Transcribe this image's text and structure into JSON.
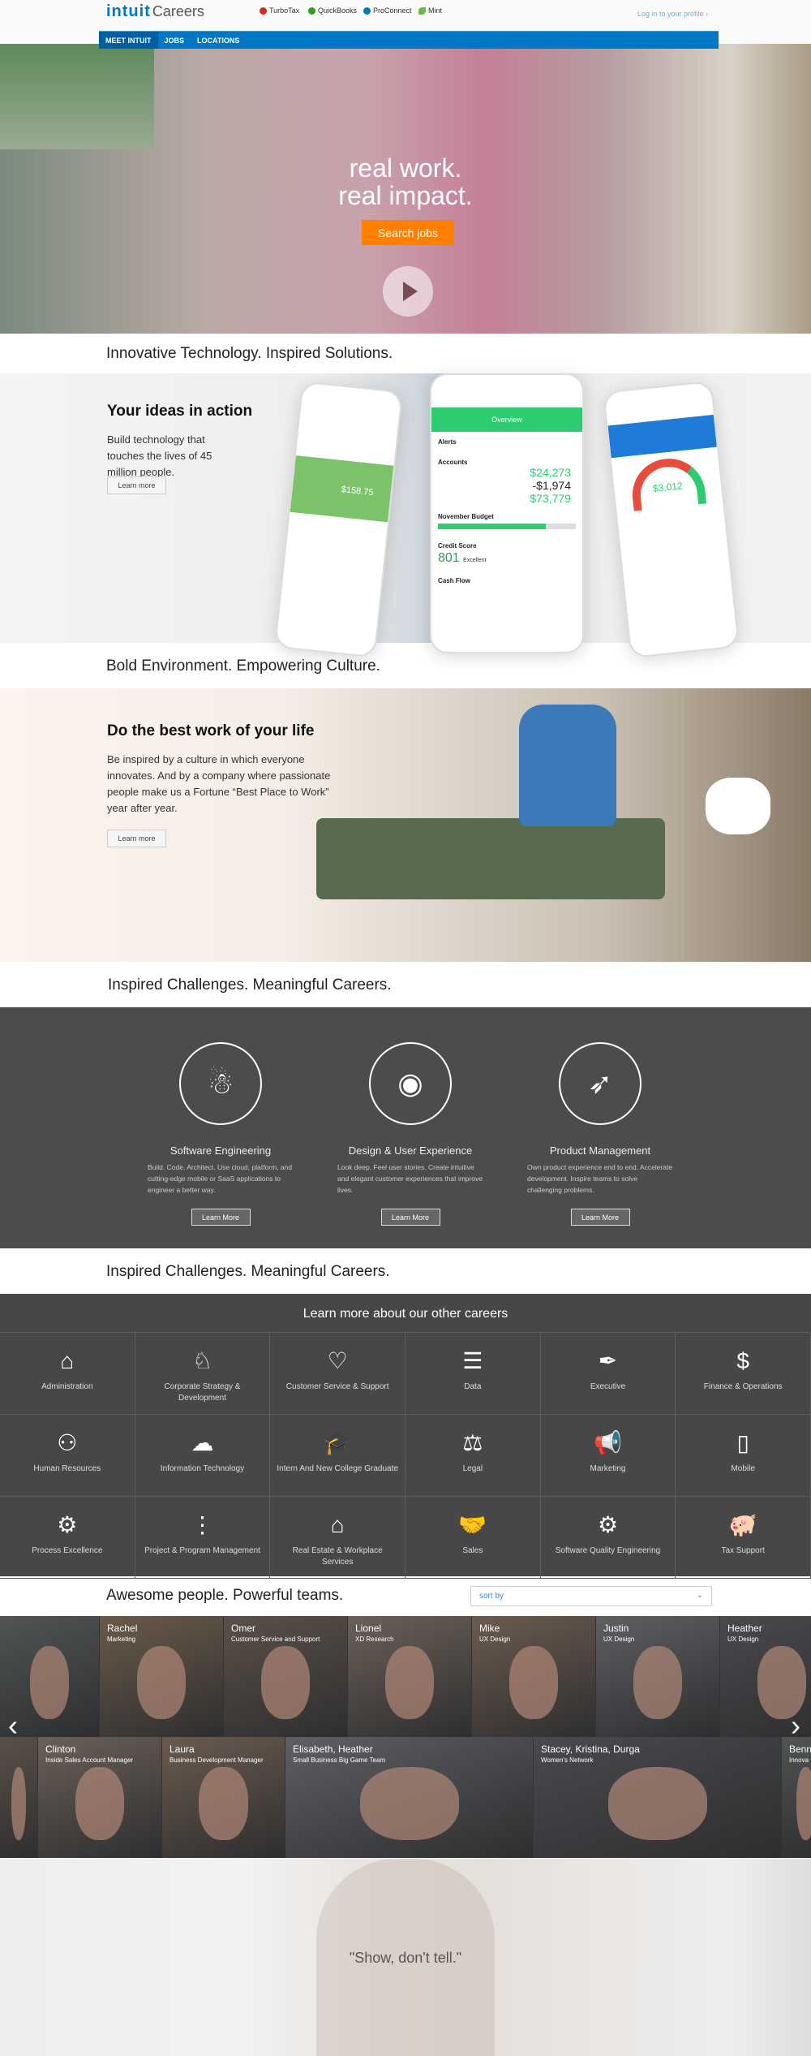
{
  "header": {
    "logo": "intuit",
    "logo_suffix": "Careers",
    "brands": [
      {
        "name": "TurboTax",
        "color": "#d52b1e"
      },
      {
        "name": "QuickBooks",
        "color": "#2ca01c"
      },
      {
        "name": "ProConnect",
        "color": "#0077c5"
      },
      {
        "name": "Mint",
        "color": "#66bb44"
      }
    ],
    "login": "Log in to your profile ›"
  },
  "nav": {
    "items": [
      "MEET INTUIT",
      "JOBS",
      "LOCATIONS"
    ],
    "active": "MEET INTUIT"
  },
  "hero": {
    "line1": "real work.",
    "line2": "real impact.",
    "cta": "Search jobs"
  },
  "sections": {
    "tech": "Innovative Technology. Inspired Solutions.",
    "culture": "Bold Environment. Empowering Culture.",
    "challenges": "Inspired Challenges. Meaningful Careers.",
    "challenges2": "Inspired Challenges. Meaningful Careers.",
    "people": "Awesome people. Powerful teams."
  },
  "ideas": {
    "title": "Your ideas in action",
    "text": "Build technology that touches the lives of 45 million people.",
    "button": "Learn more",
    "phone": {
      "header": "Overview",
      "alerts": "Alerts",
      "accounts": "Accounts",
      "cash": "$24,273",
      "debt": "-$1,974",
      "investments": "$73,779",
      "budget": "November Budget",
      "budget_progress": 0.78,
      "credit": "Credit Score",
      "score": "801",
      "score_label": "Excellent",
      "cashflow": "Cash Flow",
      "invoice_total": "$158.75",
      "refund": "$3,012"
    }
  },
  "culture": {
    "title": "Do the best work of your life",
    "text": "Be inspired by a culture in which everyone innovates. And by a company where passionate people make us a Fortune “Best Place to Work” year after year.",
    "button": "Learn more"
  },
  "careers": [
    {
      "title": "Software Engineering",
      "text": "Build. Code. Architect. Use cloud, platform, and cutting-edge mobile or SaaS applications to engineer a better way.",
      "button": "Learn More",
      "icon": "robot-icon"
    },
    {
      "title": "Design & User Experience",
      "text": "Look deep. Feel user stories. Create intuitive and elegant customer experiences that improve lives.",
      "button": "Learn More",
      "icon": "eye-icon"
    },
    {
      "title": "Product Management",
      "text": "Own product experience end to end. Accelerate development. Inspire teams to solve challenging problems.",
      "button": "Learn More",
      "icon": "rocket-icon"
    }
  ],
  "other": {
    "title": "Learn more about our other careers",
    "items": [
      {
        "label": "Administration",
        "icon": "inbox-icon",
        "glyph": "⌂"
      },
      {
        "label": "Corporate Strategy & Development",
        "icon": "chess-knight-icon",
        "glyph": "♘"
      },
      {
        "label": "Customer Service & Support",
        "icon": "heart-icon",
        "glyph": "♡"
      },
      {
        "label": "Data",
        "icon": "database-icon",
        "glyph": "☰"
      },
      {
        "label": "Executive",
        "icon": "pen-nib-icon",
        "glyph": "✒"
      },
      {
        "label": "Finance & Operations",
        "icon": "dollar-cycle-icon",
        "glyph": "$"
      },
      {
        "label": "Human Resources",
        "icon": "people-icon",
        "glyph": "⚇"
      },
      {
        "label": "Information Technology",
        "icon": "cloud-upload-icon",
        "glyph": "☁"
      },
      {
        "label": "Intern And New College Graduate",
        "icon": "graduation-cap-icon",
        "glyph": "🎓"
      },
      {
        "label": "Legal",
        "icon": "gavel-icon",
        "glyph": "⚖"
      },
      {
        "label": "Marketing",
        "icon": "megaphone-icon",
        "glyph": "📢"
      },
      {
        "label": "Mobile",
        "icon": "mobile-icon",
        "glyph": "▯"
      },
      {
        "label": "Process Excellence",
        "icon": "gears-icon",
        "glyph": "⚙"
      },
      {
        "label": "Project & Program Management",
        "icon": "traffic-light-icon",
        "glyph": "⋮"
      },
      {
        "label": "Real Estate & Workplace Services",
        "icon": "house-icon",
        "glyph": "⌂"
      },
      {
        "label": "Sales",
        "icon": "handshake-icon",
        "glyph": "🤝"
      },
      {
        "label": "Software Quality Engineering",
        "icon": "gear-icon",
        "glyph": "⚙"
      },
      {
        "label": "Tax Support",
        "icon": "piggy-bank-icon",
        "glyph": "🐖"
      }
    ]
  },
  "people": {
    "sort_placeholder": "sort by",
    "row1": [
      {
        "name": "",
        "role": ""
      },
      {
        "name": "Rachel",
        "role": "Marketing"
      },
      {
        "name": "Omer",
        "role": "Customer Service and Support"
      },
      {
        "name": "Lionel",
        "role": "XD Research"
      },
      {
        "name": "Mike",
        "role": "UX Design"
      },
      {
        "name": "Justin",
        "role": "UX Design"
      },
      {
        "name": "Heather",
        "role": "UX Design"
      }
    ],
    "row2": [
      {
        "name": "",
        "role": ""
      },
      {
        "name": "Clinton",
        "role": "Inside Sales Account Manager"
      },
      {
        "name": "Laura",
        "role": "Business Development Manager"
      },
      {
        "name": "Elisabeth, Heather",
        "role": "Small Business Big Game Team"
      },
      {
        "name": "Stacey, Kristina, Durga",
        "role": "Women's Network"
      },
      {
        "name": "Benn",
        "role": "Innova"
      }
    ]
  },
  "quote": "\"Show, don't tell.\""
}
